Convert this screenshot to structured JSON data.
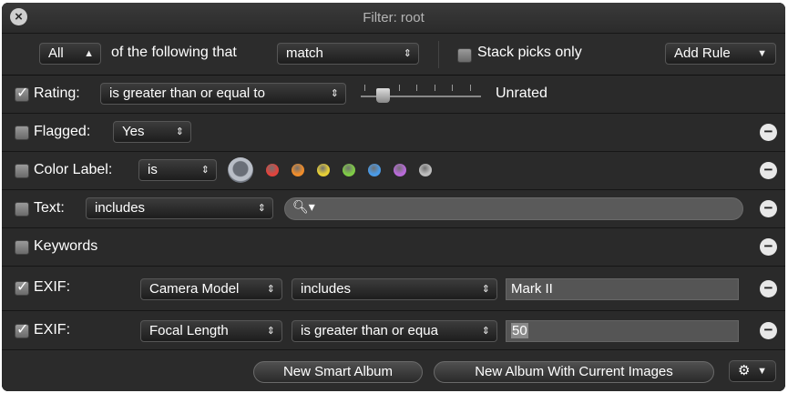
{
  "window": {
    "title": "Filter: root"
  },
  "top_bar": {
    "scope_value": "All",
    "of_text": "of the following that",
    "match_value": "match",
    "stack_picks_label": "Stack picks only",
    "add_rule_label": "Add Rule"
  },
  "rules": {
    "rating": {
      "label": "Rating:",
      "operator": "is greater than or equal to",
      "value_text": "Unrated",
      "checked": true
    },
    "flagged": {
      "label": "Flagged:",
      "value": "Yes",
      "checked": false
    },
    "color_label": {
      "label": "Color Label:",
      "operator": "is",
      "checked": false,
      "colors": [
        "#e0443d",
        "#ee8c2b",
        "#e6cf37",
        "#7fcb46",
        "#4a9ae6",
        "#b86ad8",
        "#bdbdbd"
      ]
    },
    "text": {
      "label": "Text:",
      "operator": "includes",
      "search_value": "",
      "checked": false
    },
    "keywords": {
      "label": "Keywords",
      "checked": false
    },
    "exif1": {
      "label": "EXIF:",
      "field": "Camera Model",
      "operator": "includes",
      "value": "Mark II",
      "checked": true
    },
    "exif2": {
      "label": "EXIF:",
      "field": "Focal Length",
      "operator": "is greater than or equa",
      "value": "50",
      "checked": true
    }
  },
  "bottom_bar": {
    "new_smart_album_label": "New Smart Album",
    "new_album_current_label": "New Album With Current Images"
  },
  "icons": {
    "close": "close-icon",
    "minus": "minus-icon",
    "search": "magnifier-icon",
    "gear": "gear-icon"
  }
}
